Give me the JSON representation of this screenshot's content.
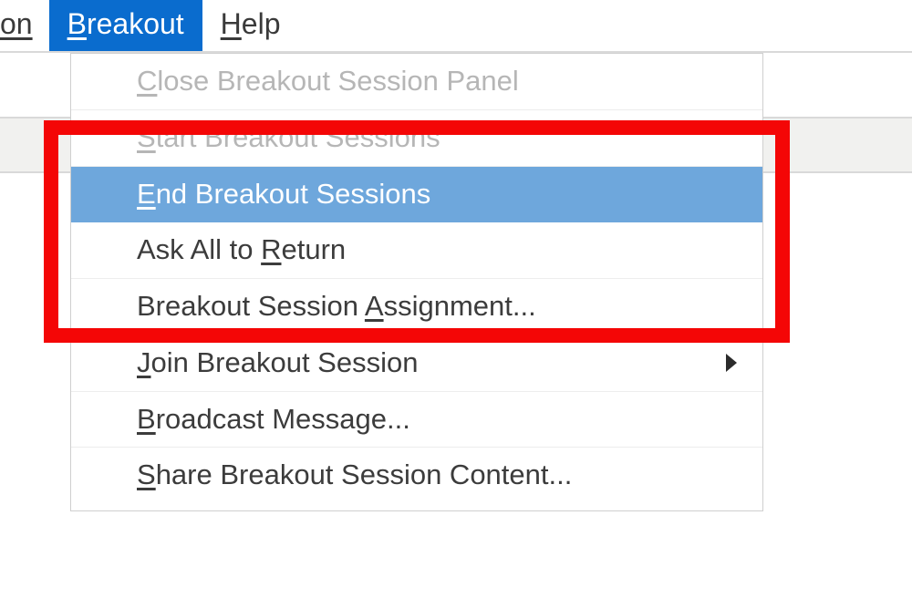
{
  "menubar": {
    "truncated_item_fragment": "on",
    "breakout_prefix": "B",
    "breakout_rest": "reakout",
    "help_prefix": "H",
    "help_rest": "elp"
  },
  "dropdown": {
    "close_panel": {
      "pre": "",
      "m": "C",
      "post": "lose Breakout Session Panel"
    },
    "start_sessions": {
      "pre": "",
      "m": "S",
      "post": "tart Breakout Sessions"
    },
    "end_sessions": {
      "pre": "",
      "m": "E",
      "post": "nd Breakout Sessions"
    },
    "ask_return": {
      "pre": "Ask All to ",
      "m": "R",
      "post": "eturn"
    },
    "assignment": {
      "pre": "Breakout Session ",
      "m": "A",
      "post": "ssignment..."
    },
    "join_session": {
      "pre": "",
      "m": "J",
      "post": "oin Breakout Session"
    },
    "broadcast": {
      "pre": "",
      "m": "B",
      "post": "roadcast Message..."
    },
    "share_content": {
      "pre": "",
      "m": "S",
      "post": "hare Breakout Session Content..."
    }
  }
}
